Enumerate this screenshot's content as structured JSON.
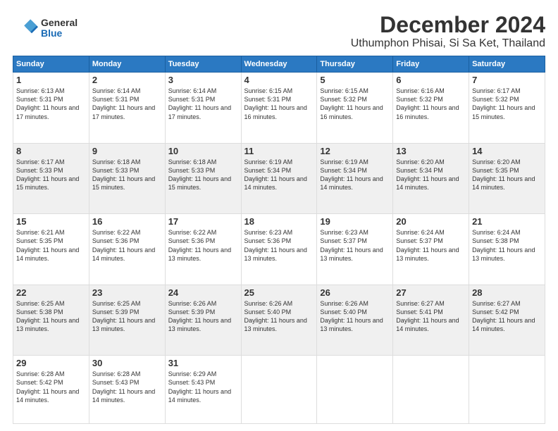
{
  "header": {
    "logo": {
      "general": "General",
      "blue": "Blue"
    },
    "title": "December 2024",
    "location": "Uthumphon Phisai, Si Sa Ket, Thailand"
  },
  "calendar": {
    "days_of_week": [
      "Sunday",
      "Monday",
      "Tuesday",
      "Wednesday",
      "Thursday",
      "Friday",
      "Saturday"
    ],
    "weeks": [
      [
        null,
        {
          "day": 2,
          "sunrise": "6:14 AM",
          "sunset": "5:31 PM",
          "daylight": "11 hours and 17 minutes."
        },
        {
          "day": 3,
          "sunrise": "6:14 AM",
          "sunset": "5:31 PM",
          "daylight": "11 hours and 17 minutes."
        },
        {
          "day": 4,
          "sunrise": "6:15 AM",
          "sunset": "5:31 PM",
          "daylight": "11 hours and 16 minutes."
        },
        {
          "day": 5,
          "sunrise": "6:15 AM",
          "sunset": "5:32 PM",
          "daylight": "11 hours and 16 minutes."
        },
        {
          "day": 6,
          "sunrise": "6:16 AM",
          "sunset": "5:32 PM",
          "daylight": "11 hours and 16 minutes."
        },
        {
          "day": 7,
          "sunrise": "6:17 AM",
          "sunset": "5:32 PM",
          "daylight": "11 hours and 15 minutes."
        }
      ],
      [
        {
          "day": 8,
          "sunrise": "6:17 AM",
          "sunset": "5:33 PM",
          "daylight": "11 hours and 15 minutes."
        },
        {
          "day": 9,
          "sunrise": "6:18 AM",
          "sunset": "5:33 PM",
          "daylight": "11 hours and 15 minutes."
        },
        {
          "day": 10,
          "sunrise": "6:18 AM",
          "sunset": "5:33 PM",
          "daylight": "11 hours and 15 minutes."
        },
        {
          "day": 11,
          "sunrise": "6:19 AM",
          "sunset": "5:34 PM",
          "daylight": "11 hours and 14 minutes."
        },
        {
          "day": 12,
          "sunrise": "6:19 AM",
          "sunset": "5:34 PM",
          "daylight": "11 hours and 14 minutes."
        },
        {
          "day": 13,
          "sunrise": "6:20 AM",
          "sunset": "5:34 PM",
          "daylight": "11 hours and 14 minutes."
        },
        {
          "day": 14,
          "sunrise": "6:20 AM",
          "sunset": "5:35 PM",
          "daylight": "11 hours and 14 minutes."
        }
      ],
      [
        {
          "day": 15,
          "sunrise": "6:21 AM",
          "sunset": "5:35 PM",
          "daylight": "11 hours and 14 minutes."
        },
        {
          "day": 16,
          "sunrise": "6:22 AM",
          "sunset": "5:36 PM",
          "daylight": "11 hours and 14 minutes."
        },
        {
          "day": 17,
          "sunrise": "6:22 AM",
          "sunset": "5:36 PM",
          "daylight": "11 hours and 13 minutes."
        },
        {
          "day": 18,
          "sunrise": "6:23 AM",
          "sunset": "5:36 PM",
          "daylight": "11 hours and 13 minutes."
        },
        {
          "day": 19,
          "sunrise": "6:23 AM",
          "sunset": "5:37 PM",
          "daylight": "11 hours and 13 minutes."
        },
        {
          "day": 20,
          "sunrise": "6:24 AM",
          "sunset": "5:37 PM",
          "daylight": "11 hours and 13 minutes."
        },
        {
          "day": 21,
          "sunrise": "6:24 AM",
          "sunset": "5:38 PM",
          "daylight": "11 hours and 13 minutes."
        }
      ],
      [
        {
          "day": 22,
          "sunrise": "6:25 AM",
          "sunset": "5:38 PM",
          "daylight": "11 hours and 13 minutes."
        },
        {
          "day": 23,
          "sunrise": "6:25 AM",
          "sunset": "5:39 PM",
          "daylight": "11 hours and 13 minutes."
        },
        {
          "day": 24,
          "sunrise": "6:26 AM",
          "sunset": "5:39 PM",
          "daylight": "11 hours and 13 minutes."
        },
        {
          "day": 25,
          "sunrise": "6:26 AM",
          "sunset": "5:40 PM",
          "daylight": "11 hours and 13 minutes."
        },
        {
          "day": 26,
          "sunrise": "6:26 AM",
          "sunset": "5:40 PM",
          "daylight": "11 hours and 13 minutes."
        },
        {
          "day": 27,
          "sunrise": "6:27 AM",
          "sunset": "5:41 PM",
          "daylight": "11 hours and 14 minutes."
        },
        {
          "day": 28,
          "sunrise": "6:27 AM",
          "sunset": "5:42 PM",
          "daylight": "11 hours and 14 minutes."
        }
      ],
      [
        {
          "day": 29,
          "sunrise": "6:28 AM",
          "sunset": "5:42 PM",
          "daylight": "11 hours and 14 minutes."
        },
        {
          "day": 30,
          "sunrise": "6:28 AM",
          "sunset": "5:43 PM",
          "daylight": "11 hours and 14 minutes."
        },
        {
          "day": 31,
          "sunrise": "6:29 AM",
          "sunset": "5:43 PM",
          "daylight": "11 hours and 14 minutes."
        },
        null,
        null,
        null,
        null
      ]
    ],
    "first_day": {
      "day": 1,
      "sunrise": "6:13 AM",
      "sunset": "5:31 PM",
      "daylight": "11 hours and 17 minutes."
    }
  }
}
